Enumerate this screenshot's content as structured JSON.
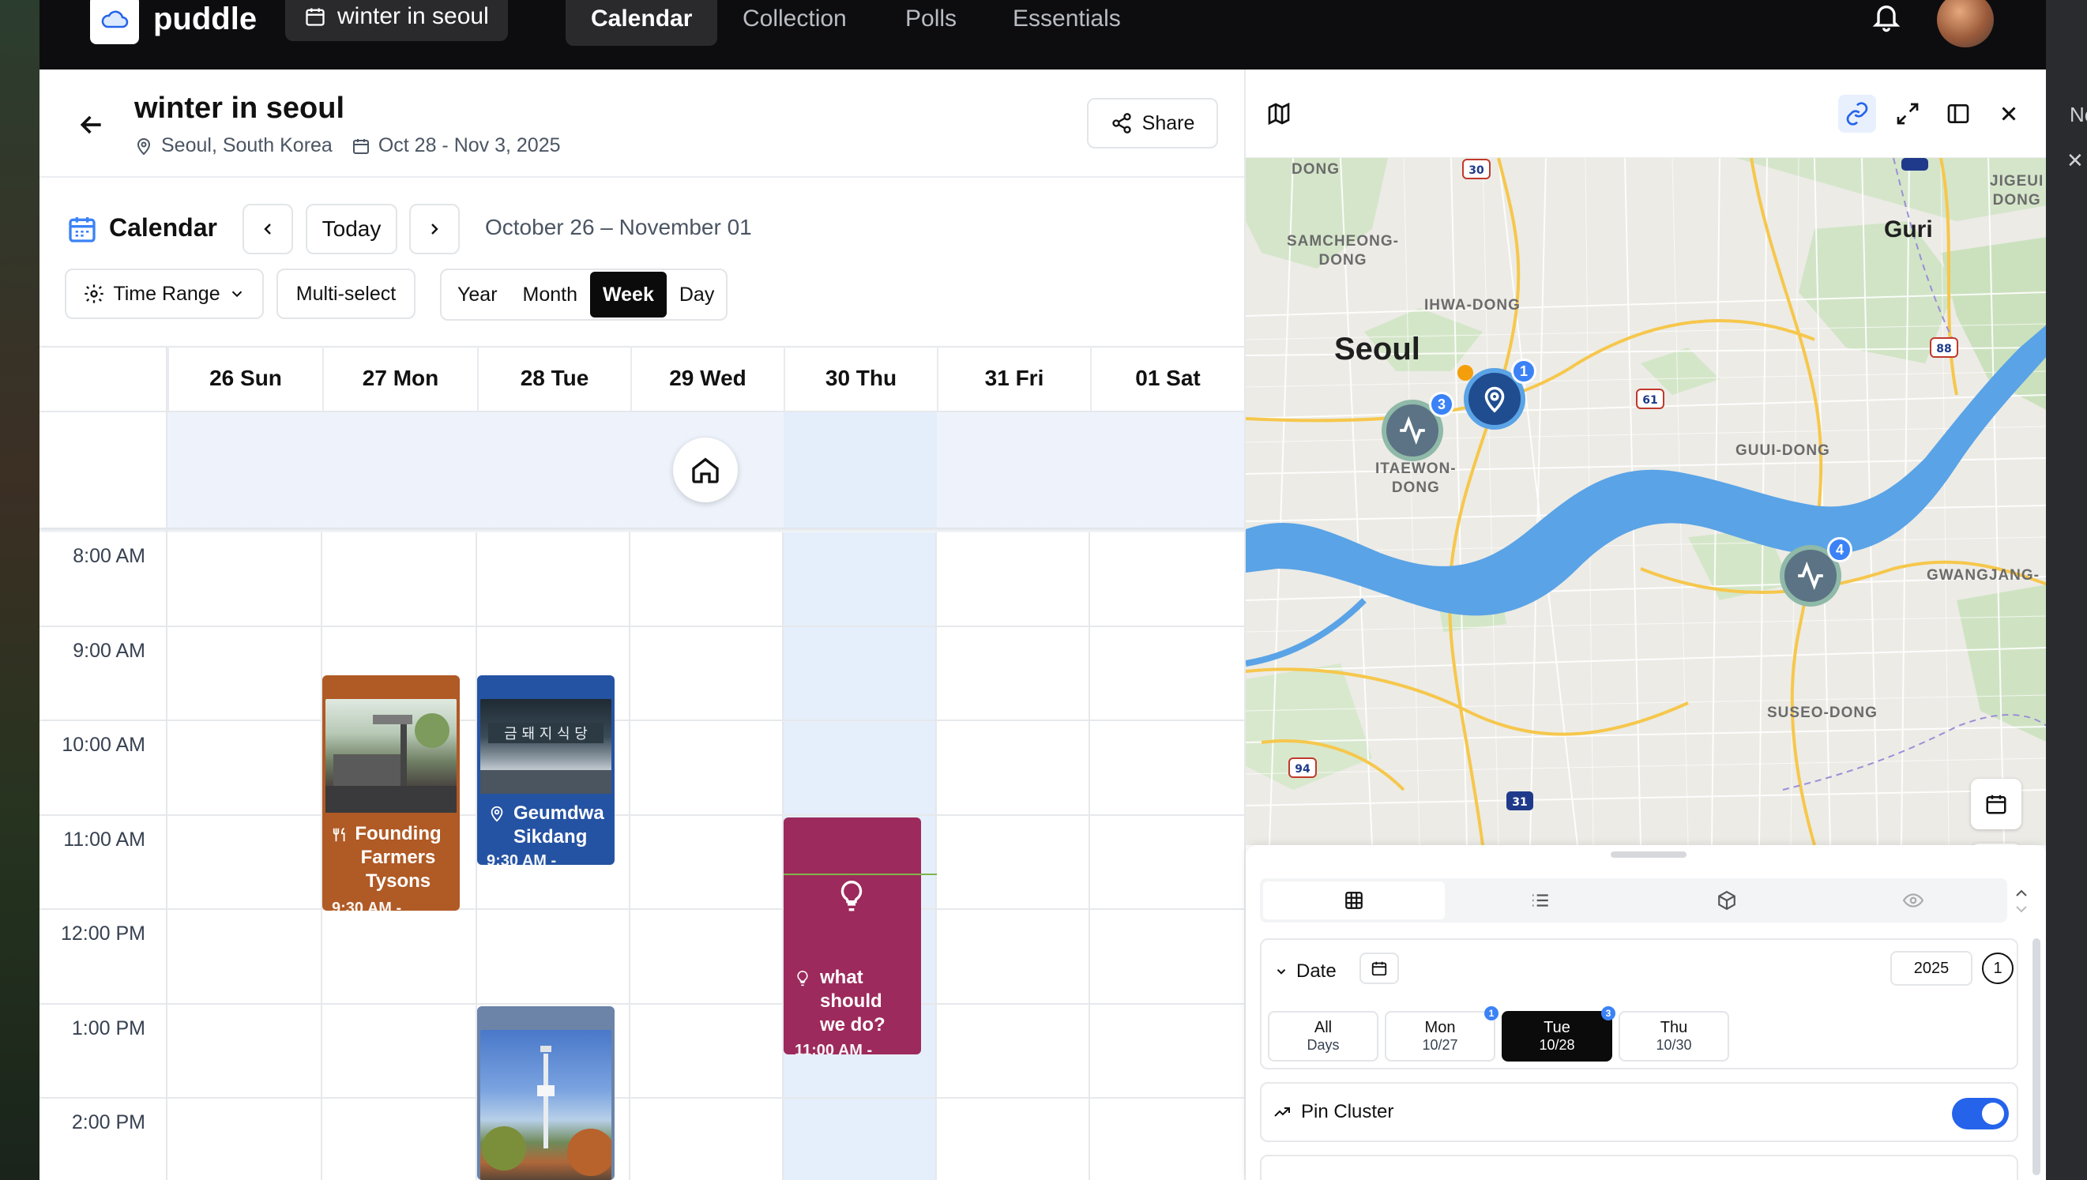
{
  "app": {
    "brand": "puddle",
    "trip_pill": "winter in seoul",
    "nav_tabs": [
      {
        "label": "Calendar",
        "active": true
      },
      {
        "label": "Collection",
        "active": false
      },
      {
        "label": "Polls",
        "active": false
      },
      {
        "label": "Essentials",
        "active": false
      }
    ]
  },
  "trip": {
    "title": "winter in seoul",
    "location": "Seoul, South Korea",
    "dates": "Oct 28 - Nov 3, 2025",
    "share_label": "Share"
  },
  "calendar": {
    "title": "Calendar",
    "today_label": "Today",
    "range_label": "October 26 – November 01",
    "time_range_label": "Time Range",
    "multiselect_label": "Multi-select",
    "views": [
      "Year",
      "Month",
      "Week",
      "Day"
    ],
    "active_view": "Week",
    "days": [
      "26 Sun",
      "27 Mon",
      "28 Tue",
      "29 Wed",
      "30 Thu",
      "31 Fri",
      "01 Sat"
    ],
    "hours": [
      "8:00 AM",
      "9:00 AM",
      "10:00 AM",
      "11:00 AM",
      "12:00 PM",
      "1:00 PM",
      "2:00 PM"
    ],
    "events": [
      {
        "day": "27 Mon",
        "title_lines": [
          "Founding",
          "Farmers",
          "Tysons"
        ],
        "time": "9:30 AM -",
        "icon": "fork-knife-icon",
        "color": "#b05a25"
      },
      {
        "day": "28 Tue",
        "title_lines": [
          "Geumdwa",
          "Sikdang"
        ],
        "time": "9:30 AM -",
        "icon": "map-pin-icon",
        "color": "#2553a3"
      },
      {
        "day": "30 Thu",
        "title_lines": [
          "what",
          "should",
          "we do?"
        ],
        "time": "11:00 AM -",
        "icon": "lightbulb-icon",
        "color": "#9d2a5c"
      },
      {
        "day": "28 Tue",
        "title_lines": [],
        "time": "",
        "icon": "",
        "color": "#6b84a8"
      }
    ]
  },
  "map": {
    "city_labels": [
      "Seoul",
      "Guri"
    ],
    "district_labels": [
      "SAMCHEONG-\nDONG",
      "IHWA-DONG",
      "ITAEWON-\nDONG",
      "GUUI-DONG",
      "GWANGJANG-",
      "SUSEO-DONG",
      "DONG",
      "JIGEUI\nDONG"
    ],
    "road_shields": [
      "30",
      "61",
      "88",
      "94",
      "31"
    ],
    "clusters": [
      {
        "count": "3",
        "type": "activity"
      },
      {
        "count": "1",
        "type": "pin"
      },
      {
        "count": "4",
        "type": "activity"
      }
    ]
  },
  "sheet": {
    "date_label": "Date",
    "year": "2025",
    "count": "1",
    "day_chips": [
      {
        "top": "All",
        "sub": "Days",
        "badge": "",
        "active": false
      },
      {
        "top": "Mon",
        "sub": "10/27",
        "badge": "1",
        "active": false
      },
      {
        "top": "Tue",
        "sub": "10/28",
        "badge": "3",
        "active": true
      },
      {
        "top": "Thu",
        "sub": "10/30",
        "badge": "",
        "active": false
      }
    ],
    "pin_cluster_label": "Pin Cluster",
    "pin_cluster_on": true
  },
  "right_strip": {
    "text": "Ne",
    "close": "✕"
  },
  "colors": {
    "accent": "#2563eb",
    "nav_bg": "#0d0d0f",
    "allday_bg": "#eef3fb",
    "today_col": "#e5effb"
  }
}
